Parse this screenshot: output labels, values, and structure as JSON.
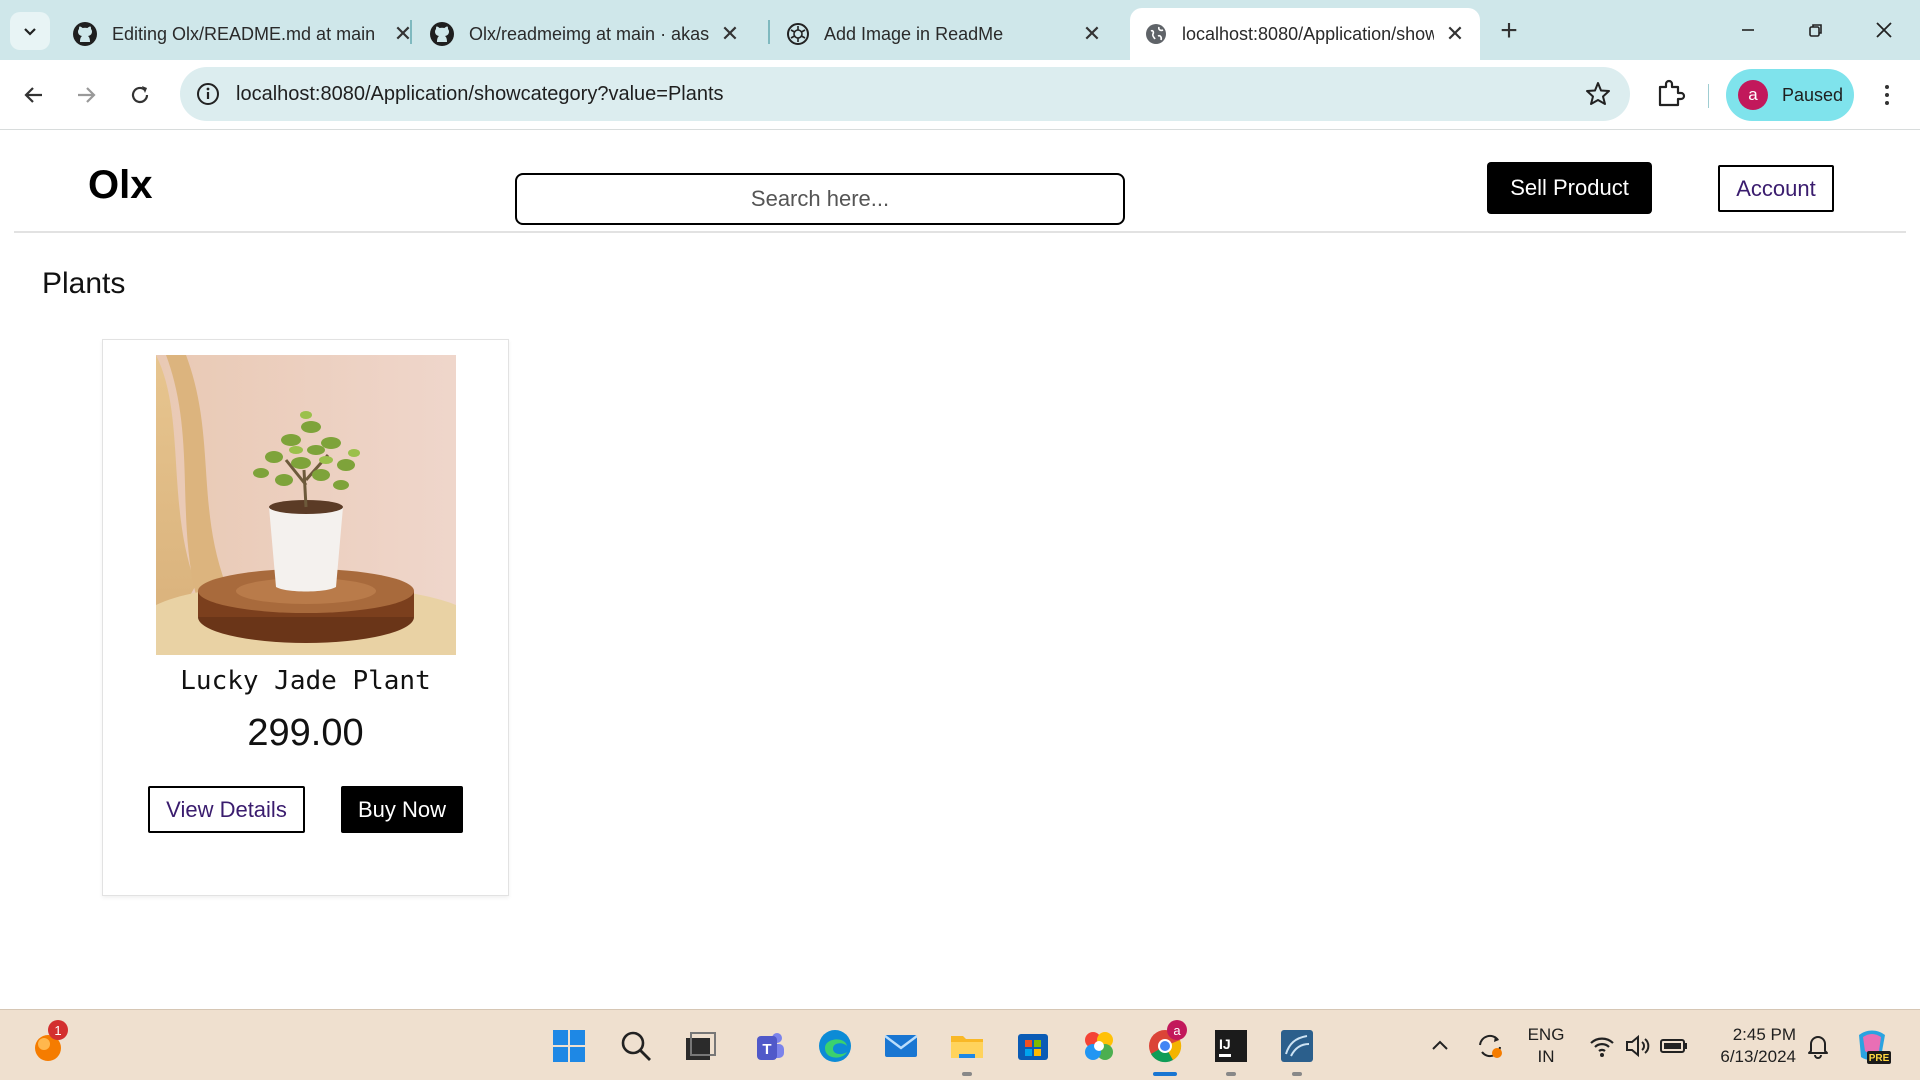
{
  "browser": {
    "tabs": [
      {
        "title": "Editing Olx/README.md at main",
        "icon": "github-icon"
      },
      {
        "title": "Olx/readmeimg at main · akash",
        "icon": "github-icon"
      },
      {
        "title": "Add Image in ReadMe",
        "icon": "chatgpt-icon"
      },
      {
        "title": "localhost:8080/Application/show",
        "icon": "globe-icon",
        "active": true
      }
    ],
    "url": "localhost:8080/Application/showcategory?value=Plants",
    "profile": {
      "initial": "a",
      "status": "Paused",
      "color": "#c2185b"
    }
  },
  "site": {
    "logo": "Olx",
    "search_placeholder": "Search here...",
    "sell_label": "Sell Product",
    "account_label": "Account"
  },
  "category": {
    "title": "Plants",
    "products": [
      {
        "name": "Lucky Jade Plant",
        "price": "299.00",
        "view_label": "View Details",
        "buy_label": "Buy Now"
      }
    ]
  },
  "taskbar": {
    "notification_count": "1",
    "chrome_badge": "a",
    "lang_top": "ENG",
    "lang_bottom": "IN",
    "time": "2:45 PM",
    "date": "6/13/2024",
    "copilot_label": "PRE"
  }
}
